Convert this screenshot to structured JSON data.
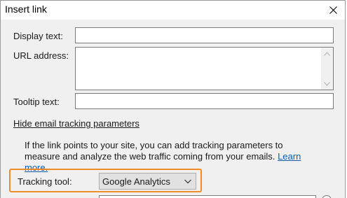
{
  "window": {
    "title": "Insert link",
    "close_icon": "close-icon"
  },
  "form": {
    "display_text": {
      "label": "Display text:",
      "value": ""
    },
    "url_address": {
      "label": "URL address:",
      "value": ""
    },
    "tooltip_text": {
      "label": "Tooltip text:",
      "value": ""
    }
  },
  "tracking": {
    "toggle_label": "Hide email tracking parameters",
    "info_text": "If the link points to your site, you can add tracking parameters to measure and analyze the web traffic coming from your emails.",
    "learn_more_label": "Learn more.",
    "tool_label": "Tracking tool:",
    "tool_selected": "Google Analytics",
    "highlight_color": "#f28c28",
    "link_color": "#0b5cad"
  }
}
